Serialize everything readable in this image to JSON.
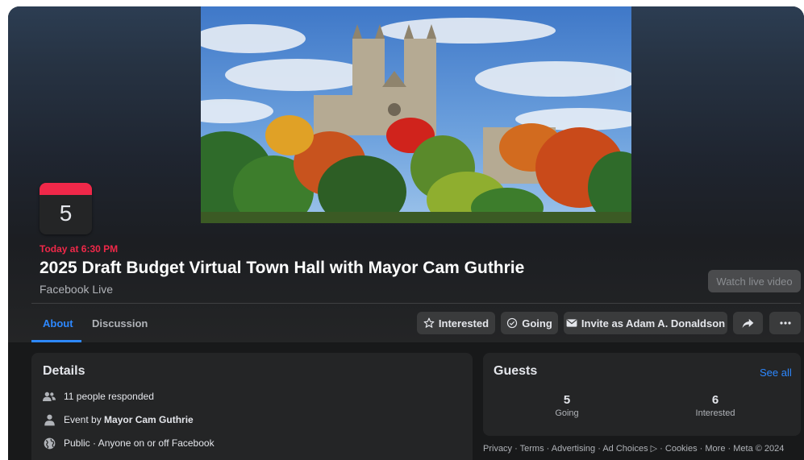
{
  "event": {
    "date_day": "5",
    "time": "Today at 6:30 PM",
    "title": "2025 Draft Budget Virtual Town Hall with Mayor Cam Guthrie",
    "location": "Facebook Live",
    "watch_label": "Watch live video"
  },
  "tabs": [
    {
      "label": "About",
      "active": true
    },
    {
      "label": "Discussion",
      "active": false
    }
  ],
  "actions": {
    "interested": "Interested",
    "going": "Going",
    "invite": "Invite as Adam A. Donaldson",
    "share_icon": "share-arrow-icon",
    "more_icon": "ellipsis-icon"
  },
  "details": {
    "title": "Details",
    "responded": "11 people responded",
    "host_prefix": "Event by ",
    "host_name": "Mayor Cam Guthrie",
    "privacy": "Public · Anyone on or off Facebook"
  },
  "guests": {
    "title": "Guests",
    "see_all": "See all",
    "going_count": "5",
    "going_label": "Going",
    "interested_count": "6",
    "interested_label": "Interested"
  },
  "footer": {
    "text": "Privacy · Terms · Advertising · Ad Choices ▷ · Cookies · More · Meta © 2024"
  },
  "colors": {
    "accent": "#2d88ff",
    "date_red": "#f02849",
    "card_bg": "#242526",
    "page_bg": "#18191a"
  }
}
